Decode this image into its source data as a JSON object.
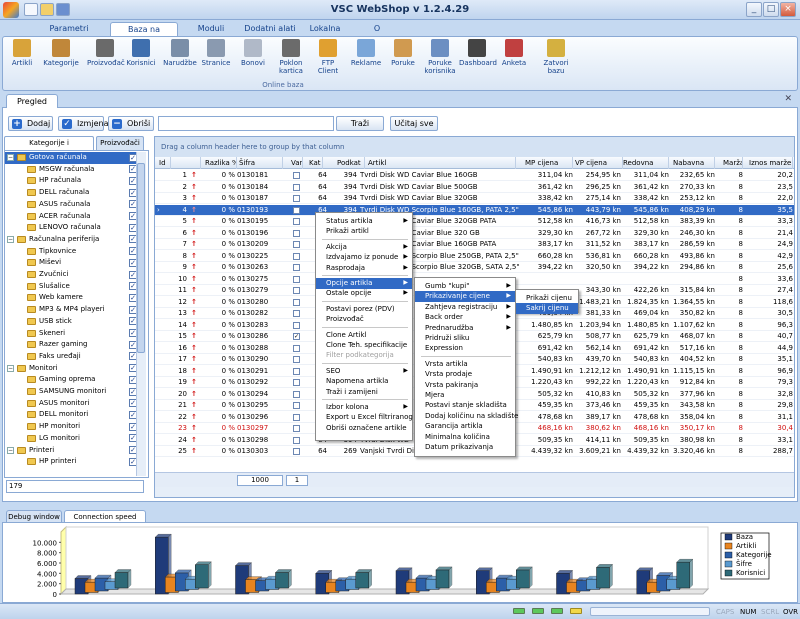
{
  "app": {
    "title": "VSC WebShop  v 1.2.4.29"
  },
  "ribbon_tabs": [
    "Parametri programa",
    "Baza na internetu",
    "Moduli programa",
    "Dodatni alati",
    "Lokalna baza",
    "O programu"
  ],
  "ribbon_buttons": [
    {
      "label": "Artikli",
      "icon": "boxes-icon",
      "color": "#d8a33a"
    },
    {
      "label": "Kategorije",
      "icon": "category-tree-icon",
      "color": "#c0873a"
    },
    {
      "label": "Proizvođač",
      "icon": "factory-icon",
      "color": "#6a6a6a"
    },
    {
      "label": "Korisnici",
      "icon": "users-icon",
      "color": "#3f6fae"
    },
    {
      "label": "Narudžbe",
      "icon": "order-list-icon",
      "color": "#7a8ea8"
    },
    {
      "label": "Stranice",
      "icon": "pages-icon",
      "color": "#8a9ab0"
    },
    {
      "label": "Bonovi",
      "icon": "voucher-icon",
      "color": "#b0b9c8"
    },
    {
      "label": "Poklon\nkartica",
      "icon": "gift-card-icon",
      "color": "#6b6b6b"
    },
    {
      "label": "FTP\nClient",
      "icon": "ftp-folder-icon",
      "color": "#e0a030"
    },
    {
      "label": "Reklame",
      "icon": "banner-icon",
      "color": "#7aa6d8"
    },
    {
      "label": "Poruke",
      "icon": "message-icon",
      "color": "#d09a50"
    },
    {
      "label": "Poruke\nkorisnika",
      "icon": "user-message-icon",
      "color": "#6c8fc2"
    },
    {
      "label": "Dashboard",
      "icon": "dashboard-icon",
      "color": "#444444"
    },
    {
      "label": "Anketa",
      "icon": "poll-chart-icon",
      "color": "#c04040"
    },
    {
      "label": "Zatvori\nbazu",
      "icon": "lock-db-icon",
      "color": "#d4b040"
    }
  ],
  "ribbon_group_label": "Online baza",
  "doc_tab": "Pregled artikla",
  "toolbar": {
    "add": "Dodaj",
    "edit": "Izmjena",
    "delete": "Obriši",
    "search_value": "",
    "search_btn": "Traži",
    "load_all": "Učitaj sve"
  },
  "left_tabs": [
    "Kategorije i podkategorije",
    "Proizvođači"
  ],
  "tree": [
    {
      "label": "Gotova računala",
      "level": 0,
      "checked": true,
      "selected": true
    },
    {
      "label": "MSGW računala",
      "level": 1,
      "checked": true
    },
    {
      "label": "HP računala",
      "level": 1,
      "checked": true
    },
    {
      "label": "DELL računala",
      "level": 1,
      "checked": true
    },
    {
      "label": "ASUS računala",
      "level": 1,
      "checked": true
    },
    {
      "label": "ACER računala",
      "level": 1,
      "checked": true
    },
    {
      "label": "LENOVO računala",
      "level": 1,
      "checked": true
    },
    {
      "label": "Računalna periferija",
      "level": 0,
      "checked": true
    },
    {
      "label": "Tipkovnice",
      "level": 1,
      "checked": true
    },
    {
      "label": "Miševi",
      "level": 1,
      "checked": true
    },
    {
      "label": "Zvučnici",
      "level": 1,
      "checked": true
    },
    {
      "label": "Slušalice",
      "level": 1,
      "checked": true
    },
    {
      "label": "Web kamere",
      "level": 1,
      "checked": true
    },
    {
      "label": "MP3 & MP4 playeri",
      "level": 1,
      "checked": true
    },
    {
      "label": "USB stick",
      "level": 1,
      "checked": true
    },
    {
      "label": "Skeneri",
      "level": 1,
      "checked": true
    },
    {
      "label": "Razer gaming",
      "level": 1,
      "checked": true
    },
    {
      "label": "Faks uređaji",
      "level": 1,
      "checked": true
    },
    {
      "label": "Monitori",
      "level": 0,
      "checked": true
    },
    {
      "label": "Gaming oprema",
      "level": 1,
      "checked": true
    },
    {
      "label": "SAMSUNG monitori",
      "level": 1,
      "checked": true
    },
    {
      "label": "ASUS monitori",
      "level": 1,
      "checked": true
    },
    {
      "label": "DELL monitori",
      "level": 1,
      "checked": true
    },
    {
      "label": "HP monitori",
      "level": 1,
      "checked": true
    },
    {
      "label": "LG monitori",
      "level": 1,
      "checked": true
    },
    {
      "label": "Printeri",
      "level": 0,
      "checked": true
    },
    {
      "label": "HP printeri",
      "level": 1,
      "checked": true
    }
  ],
  "tree_count": "179",
  "grid": {
    "group_hint": "Drag a column header here to group by that column",
    "columns": [
      "Id",
      "",
      "Razlika %",
      "Šifra",
      "Var",
      "Kat",
      "Podkat",
      "Artikl",
      "MP cijena",
      "VP cijena",
      "Redovna",
      "Nabavna",
      "Marža %",
      "Iznos marže"
    ],
    "rows": [
      {
        "id": "1",
        "dif": "0 %",
        "sku": "0130181",
        "kat": "64",
        "pod": "394",
        "name": "Tvrdi Disk WD Caviar Blue 160GB",
        "mp": "311,04 kn",
        "vp": "254,95 kn",
        "red": "311,04 kn",
        "nab": "232,65 kn",
        "mar": "8",
        "iz": "20,2"
      },
      {
        "id": "2",
        "dif": "0 %",
        "sku": "0130184",
        "kat": "64",
        "pod": "394",
        "name": "Tvrdi Disk WD Caviar Blue 500GB",
        "mp": "361,42 kn",
        "vp": "296,25 kn",
        "red": "361,42 kn",
        "nab": "270,33 kn",
        "mar": "8",
        "iz": "23,5"
      },
      {
        "id": "3",
        "dif": "0 %",
        "sku": "0130187",
        "kat": "64",
        "pod": "394",
        "name": "Tvrdi Disk WD Caviar Blue 320GB",
        "mp": "338,42 kn",
        "vp": "275,14 kn",
        "red": "338,42 kn",
        "nab": "253,12 kn",
        "mar": "8",
        "iz": "22,0"
      },
      {
        "id": "4",
        "dif": "0 %",
        "sku": "0130193",
        "kat": "64",
        "pod": "394",
        "name": "Tvrdi Disk WD Scorpio Blue 160GB, PATA 2,5\"",
        "mp": "545,86 kn",
        "vp": "443,79 kn",
        "red": "545,86 kn",
        "nab": "408,29 kn",
        "mar": "8",
        "iz": "35,5",
        "sel": true
      },
      {
        "id": "5",
        "dif": "0 %",
        "sku": "0130195",
        "kat": "",
        "pod": "",
        "name": "Tvrdi Disk WD Caviar Blue 320GB PATA",
        "mp": "512,58 kn",
        "vp": "416,73 kn",
        "red": "512,58 kn",
        "nab": "383,39 kn",
        "mar": "8",
        "iz": "33,3"
      },
      {
        "id": "6",
        "dif": "0 %",
        "sku": "0130196",
        "kat": "",
        "pod": "",
        "name": "Tvrdi Disk WD Caviar Blue 320 GB",
        "mp": "329,30 kn",
        "vp": "267,72 kn",
        "red": "329,30 kn",
        "nab": "246,30 kn",
        "mar": "8",
        "iz": "21,4"
      },
      {
        "id": "7",
        "dif": "0 %",
        "sku": "0130209",
        "kat": "",
        "pod": "",
        "name": "Tvrdi Disk WD Caviar Blue 160GB PATA",
        "mp": "383,17 kn",
        "vp": "311,52 kn",
        "red": "383,17 kn",
        "nab": "286,59 kn",
        "mar": "8",
        "iz": "24,9"
      },
      {
        "id": "8",
        "dif": "0 %",
        "sku": "0130225",
        "kat": "",
        "pod": "",
        "name": "Tvrdi Disk WD Scorpio Blue 250GB, PATA 2,5\"",
        "mp": "660,28 kn",
        "vp": "536,81 kn",
        "red": "660,28 kn",
        "nab": "493,86 kn",
        "mar": "8",
        "iz": "42,9"
      },
      {
        "id": "9",
        "dif": "0 %",
        "sku": "0130263",
        "kat": "",
        "pod": "",
        "name": "Tvrdi Disk WD Scorpio Blue 320GB, SATA 2,5\"",
        "mp": "394,22 kn",
        "vp": "320,50 kn",
        "red": "394,22 kn",
        "nab": "294,86 kn",
        "mar": "8",
        "iz": "25,6"
      },
      {
        "id": "10",
        "dif": "0 %",
        "sku": "0130275",
        "kat": "",
        "pod": "",
        "name": "",
        "mp": "",
        "vp": "",
        "red": "",
        "nab": "",
        "mar": "8",
        "iz": "33,6"
      },
      {
        "id": "11",
        "dif": "0 %",
        "sku": "0130279",
        "kat": "",
        "pod": "",
        "name": "",
        "mp": "",
        "vp": "343,30 kn",
        "red": "422,26 kn",
        "nab": "315,84 kn",
        "mar": "8",
        "iz": "27,4"
      },
      {
        "id": "12",
        "dif": "0 %",
        "sku": "0130280",
        "kat": "",
        "pod": "",
        "name": "",
        "mp": "",
        "vp": "1.483,21 kn",
        "red": "1.824,35 kn",
        "nab": "1.364,55 kn",
        "mar": "8",
        "iz": "118,6"
      },
      {
        "id": "13",
        "dif": "0 %",
        "sku": "0130282",
        "kat": "",
        "pod": "",
        "name": "",
        "mp": "469,04 kn",
        "vp": "381,33 kn",
        "red": "469,04 kn",
        "nab": "350,82 kn",
        "mar": "8",
        "iz": "30,5"
      },
      {
        "id": "14",
        "dif": "0 %",
        "sku": "0130283",
        "kat": "",
        "pod": "",
        "name": "",
        "mp": "1.480,85 kn",
        "vp": "1.203,94 kn",
        "red": "1.480,85 kn",
        "nab": "1.107,62 kn",
        "mar": "8",
        "iz": "96,3"
      },
      {
        "id": "15",
        "dif": "0 %",
        "sku": "0130286",
        "kat": "",
        "pod": "",
        "name": "",
        "mp": "625,79 kn",
        "vp": "508,77 kn",
        "red": "625,79 kn",
        "nab": "468,07 kn",
        "mar": "8",
        "iz": "40,7"
      },
      {
        "id": "16",
        "dif": "0 %",
        "sku": "0130288",
        "kat": "",
        "pod": "",
        "name": "",
        "mp": "691,42 kn",
        "vp": "562,14 kn",
        "red": "691,42 kn",
        "nab": "517,16 kn",
        "mar": "8",
        "iz": "44,9"
      },
      {
        "id": "17",
        "dif": "0 %",
        "sku": "0130290",
        "kat": "",
        "pod": "",
        "name": "",
        "mp": "540,83 kn",
        "vp": "439,70 kn",
        "red": "540,83 kn",
        "nab": "404,52 kn",
        "mar": "8",
        "iz": "35,1"
      },
      {
        "id": "18",
        "dif": "0 %",
        "sku": "0130291",
        "kat": "",
        "pod": "",
        "name": "",
        "mp": "1.490,91 kn",
        "vp": "1.212,12 kn",
        "red": "1.490,91 kn",
        "nab": "1.115,15 kn",
        "mar": "8",
        "iz": "96,9"
      },
      {
        "id": "19",
        "dif": "0 %",
        "sku": "0130292",
        "kat": "",
        "pod": "",
        "name": "",
        "mp": "1.220,43 kn",
        "vp": "992,22 kn",
        "red": "1.220,43 kn",
        "nab": "912,84 kn",
        "mar": "8",
        "iz": "79,3"
      },
      {
        "id": "20",
        "dif": "0 %",
        "sku": "0130294",
        "kat": "",
        "pod": "",
        "name": "",
        "mp": "505,32 kn",
        "vp": "410,83 kn",
        "red": "505,32 kn",
        "nab": "377,96 kn",
        "mar": "8",
        "iz": "32,8"
      },
      {
        "id": "21",
        "dif": "0 %",
        "sku": "0130295",
        "kat": "",
        "pod": "",
        "name": "",
        "mp": "459,35 kn",
        "vp": "373,46 kn",
        "red": "459,35 kn",
        "nab": "343,58 kn",
        "mar": "8",
        "iz": "29,8"
      },
      {
        "id": "22",
        "dif": "0 %",
        "sku": "0130296",
        "kat": "",
        "pod": "",
        "name": "",
        "mp": "478,68 kn",
        "vp": "389,17 kn",
        "red": "478,68 kn",
        "nab": "358,04 kn",
        "mar": "8",
        "iz": "31,1"
      },
      {
        "id": "23",
        "dif": "0 %",
        "sku": "0130297",
        "kat": "",
        "pod": "",
        "name": "",
        "mp": "468,16 kn",
        "vp": "380,62 kn",
        "red": "468,16 kn",
        "nab": "350,17 kn",
        "mar": "8",
        "iz": "30,4",
        "red_row": true
      },
      {
        "id": "24",
        "dif": "0 %",
        "sku": "0130298",
        "kat": "64",
        "pod": "394",
        "name": "Tvrdi Disk WD",
        "mp": "509,35 kn",
        "vp": "414,11 kn",
        "red": "509,35 kn",
        "nab": "380,98 kn",
        "mar": "8",
        "iz": "33,1"
      },
      {
        "id": "25",
        "dif": "0 %",
        "sku": "0130303",
        "kat": "64",
        "pod": "269",
        "name": "Vanjski Tvrdi Disk WD SharePlace 4TB",
        "mp": "4.439,32 kn",
        "vp": "3.609,21 kn",
        "red": "4.439,32 kn",
        "nab": "3.320,46 kn",
        "mar": "8",
        "iz": "288,7"
      }
    ],
    "footer_count": "1000",
    "footer_page": "1"
  },
  "context_menu": {
    "items": [
      {
        "label": "Status artikla",
        "sub": true
      },
      {
        "label": "Prikaži artikl"
      },
      {
        "sep": true
      },
      {
        "label": "Akcija",
        "sub": true
      },
      {
        "label": "Izdvajamo iz ponude",
        "sub": true
      },
      {
        "label": "Rasprodaja",
        "sub": true
      },
      {
        "sep": true
      },
      {
        "label": "Opcije artikla",
        "sub": true,
        "sel": true
      },
      {
        "label": "Ostale opcije",
        "sub": true
      },
      {
        "sep": true
      },
      {
        "label": "Postavi porez (PDV)"
      },
      {
        "label": "Proizvođač"
      },
      {
        "sep": true
      },
      {
        "label": "Clone Artikl"
      },
      {
        "label": "Clone Teh. specifikacije"
      },
      {
        "label": "Filter podkategorija",
        "dis": true
      },
      {
        "sep": true
      },
      {
        "label": "SEO",
        "sub": true
      },
      {
        "label": "Napomena artikla"
      },
      {
        "label": "Traži i zamijeni"
      },
      {
        "sep": true
      },
      {
        "label": "Izbor kolona",
        "sub": true
      },
      {
        "label": "Export u Excel filtriranog"
      },
      {
        "label": "Obriši označene artikle"
      }
    ],
    "submenu1": [
      {
        "label": "Gumb \"kupi\"",
        "sub": true
      },
      {
        "label": "Prikazivanje cijene",
        "sub": true,
        "sel": true
      },
      {
        "label": "Zahtjeva registraciju",
        "sub": true
      },
      {
        "label": "Back order",
        "sub": true
      },
      {
        "label": "Prednarudžba",
        "sub": true
      },
      {
        "label": "Pridruži sliku"
      },
      {
        "label": "Expression"
      },
      {
        "sep": true
      },
      {
        "label": "Vrsta artikla"
      },
      {
        "label": "Vrsta prodaje"
      },
      {
        "label": "Vrsta pakiranja"
      },
      {
        "label": "Mjera"
      },
      {
        "label": "Postavi stanje skladišta"
      },
      {
        "label": "Dodaj količinu na skladište"
      },
      {
        "label": "Garancija artikla"
      },
      {
        "label": "Minimalna količina"
      },
      {
        "label": "Datum prikazivanja"
      }
    ],
    "submenu2": [
      {
        "label": "Prikaži cijenu"
      },
      {
        "label": "Sakrij cijenu",
        "sel": true
      }
    ]
  },
  "bottom_tabs": [
    "Debug window",
    "Connection speed chart"
  ],
  "chart_data": {
    "type": "bar",
    "categories": [
      "1",
      "2",
      "3",
      "4",
      "5",
      "6",
      "7",
      "8"
    ],
    "series": [
      {
        "name": "Baza",
        "values": [
          3000,
          11000,
          5500,
          4000,
          4500,
          4500,
          4000,
          4500
        ],
        "color": "#1f3b7a"
      },
      {
        "name": "Artikli",
        "values": [
          2000,
          3000,
          2500,
          2000,
          2000,
          2000,
          2000,
          2000
        ],
        "color": "#e8841f"
      },
      {
        "name": "Kategorije",
        "values": [
          2500,
          3500,
          2000,
          2000,
          2500,
          2500,
          2000,
          3000
        ],
        "color": "#2c5fa8"
      },
      {
        "name": "Šifre",
        "values": [
          1500,
          2000,
          2000,
          2000,
          2000,
          2000,
          2000,
          2000
        ],
        "color": "#5a9ad0"
      },
      {
        "name": "Korisnici",
        "values": [
          3000,
          4500,
          3000,
          3000,
          3500,
          3500,
          4000,
          5000
        ],
        "color": "#2e6a78"
      }
    ],
    "y_ticks": [
      "10.000",
      "8.000",
      "6.000",
      "4.000",
      "2.000",
      "0"
    ],
    "ylim": [
      0,
      12000
    ]
  },
  "status": {
    "caps": "CAPS",
    "num": "NUM",
    "scrl": "SCRL",
    "ovr": "OVR"
  }
}
